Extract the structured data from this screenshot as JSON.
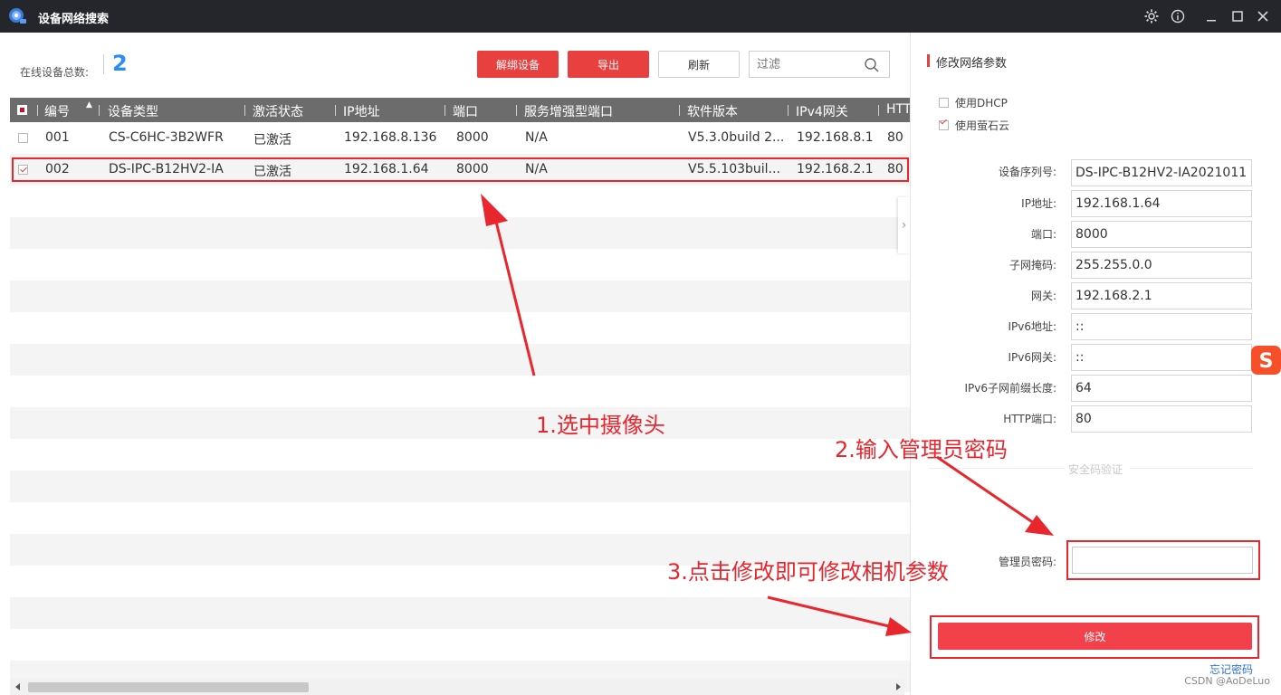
{
  "window": {
    "title": "设备网络搜索",
    "controls": [
      "gear-icon",
      "info-icon",
      "minimize-icon",
      "maximize-icon",
      "close-icon"
    ]
  },
  "summary": {
    "total_label": "在线设备总数:",
    "total_count": "2"
  },
  "toolbar": {
    "unbind_label": "解绑设备",
    "export_label": "导出",
    "refresh_label": "刷新",
    "filter_placeholder": "过滤"
  },
  "table": {
    "columns": [
      "编号",
      "设备类型",
      "激活状态",
      "IP地址",
      "端口",
      "服务增强型端口",
      "软件版本",
      "IPv4网关",
      "HTTP"
    ],
    "rows": [
      {
        "checked": false,
        "id": "001",
        "type": "CS-C6HC-3B2WFR",
        "status": "已激活",
        "ip": "192.168.8.136",
        "port": "8000",
        "enh_port": "N/A",
        "version": "V5.3.0build 2...",
        "gateway": "192.168.8.1",
        "http": "80"
      },
      {
        "checked": true,
        "id": "002",
        "type": "DS-IPC-B12HV2-IA",
        "status": "已激活",
        "ip": "192.168.1.64",
        "port": "8000",
        "enh_port": "N/A",
        "version": "V5.5.103buil...",
        "gateway": "192.168.2.1",
        "http": "80"
      }
    ]
  },
  "panel": {
    "title": "修改网络参数",
    "dhcp_label": "使用DHCP",
    "dhcp_checked": false,
    "ezviz_label": "使用萤石云",
    "ezviz_checked": true,
    "fields": [
      {
        "label": "设备序列号:",
        "value": "DS-IPC-B12HV2-IA2021011"
      },
      {
        "label": "IP地址:",
        "value": "192.168.1.64"
      },
      {
        "label": "端口:",
        "value": "8000"
      },
      {
        "label": "子网掩码:",
        "value": "255.255.0.0"
      },
      {
        "label": "网关:",
        "value": "192.168.2.1"
      },
      {
        "label": "IPv6地址:",
        "value": "::"
      },
      {
        "label": "IPv6网关:",
        "value": "::"
      },
      {
        "label": "IPv6子网前缀长度:",
        "value": "64"
      },
      {
        "label": "HTTP端口:",
        "value": "80"
      }
    ],
    "security_label": "安全码验证",
    "admin_pwd_label": "管理员密码:",
    "modify_label": "修改",
    "forgot_label": "忘记密码"
  },
  "annotations": {
    "step1": "1.选中摄像头",
    "step2": "2.输入管理员密码",
    "step3": "3.点击修改即可修改相机参数"
  },
  "watermark": "CSDN @AoDeLuo",
  "colors": {
    "titlebar": "#24262b",
    "accent_red": "#e8403f",
    "annotation_red": "#e8262e",
    "count_blue": "#2d8cf0",
    "header_gray": "#6c6c6c"
  }
}
